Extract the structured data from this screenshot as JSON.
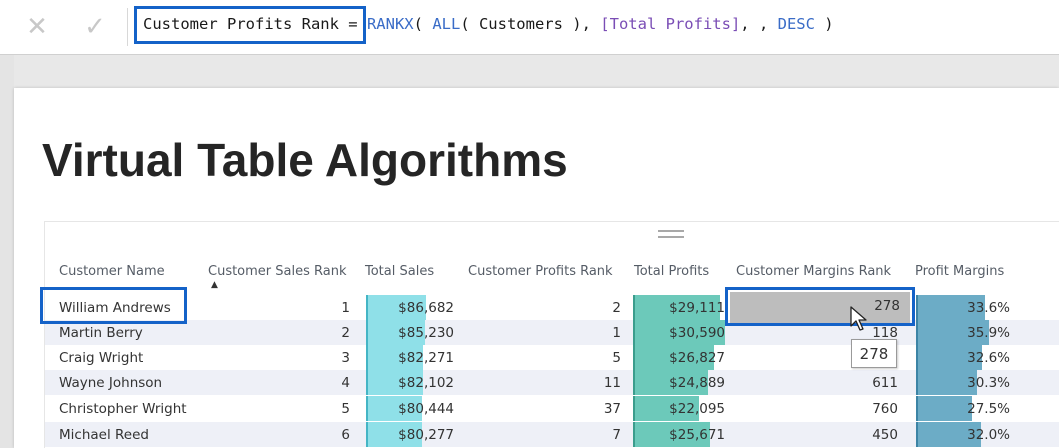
{
  "formula_bar": {
    "cancel_icon": "close-x-icon",
    "commit_icon": "checkmark-icon",
    "measure_name": "Customer Profits Rank",
    "equals": " = ",
    "fn_rankx": "RANKX",
    "paren_open": "( ",
    "fn_all": "ALL",
    "all_arg": "( Customers ), ",
    "ref_total_profits": "[Total Profits]",
    "comma_gap": ", , ",
    "desc": "DESC",
    "close": " )"
  },
  "page": {
    "title": "Virtual Table Algorithms"
  },
  "table": {
    "columns": {
      "customer_name": "Customer Name",
      "sales_rank": "Customer Sales Rank",
      "total_sales": "Total Sales",
      "profits_rank": "Customer Profits Rank",
      "total_profits": "Total Profits",
      "margins_rank": "Customer Margins Rank",
      "profit_margins": "Profit Margins"
    },
    "sort_indicator": "▲",
    "rows": [
      {
        "name": "William Andrews",
        "sales_rank": "1",
        "total_sales": "$86,682",
        "profits_rank": "2",
        "total_profits": "$29,111",
        "margins_rank": "278",
        "profit_margins": "33.6%"
      },
      {
        "name": "Martin Berry",
        "sales_rank": "2",
        "total_sales": "$85,230",
        "profits_rank": "1",
        "total_profits": "$30,590",
        "margins_rank": "118",
        "profit_margins": "35.9%"
      },
      {
        "name": "Craig Wright",
        "sales_rank": "3",
        "total_sales": "$82,271",
        "profits_rank": "5",
        "total_profits": "$26,827",
        "margins_rank": "",
        "profit_margins": "32.6%"
      },
      {
        "name": "Wayne Johnson",
        "sales_rank": "4",
        "total_sales": "$82,102",
        "profits_rank": "11",
        "total_profits": "$24,889",
        "margins_rank": "611",
        "profit_margins": "30.3%"
      },
      {
        "name": "Christopher Wright",
        "sales_rank": "5",
        "total_sales": "$80,444",
        "profits_rank": "37",
        "total_profits": "$22,095",
        "margins_rank": "760",
        "profit_margins": "27.5%"
      },
      {
        "name": "Michael Reed",
        "sales_rank": "6",
        "total_sales": "$80,277",
        "profits_rank": "7",
        "total_profits": "$25,671",
        "margins_rank": "450",
        "profit_margins": "32.0%"
      }
    ],
    "bar_fractions": {
      "total_sales": [
        1.0,
        0.98,
        0.95,
        0.95,
        0.93,
        0.93
      ],
      "total_profits": [
        0.95,
        1.0,
        0.88,
        0.81,
        0.72,
        0.84
      ],
      "profit_margins": [
        0.94,
        1.0,
        0.91,
        0.84,
        0.77,
        0.89
      ]
    }
  },
  "tooltip": {
    "value": "278"
  },
  "colors": {
    "highlight_border": "#1462c8",
    "sales_bar": "#8fe0e8",
    "profits_bar": "#6cc9ba",
    "margins_bar": "#6cacc6",
    "hover_cell": "#bdbdbd"
  }
}
